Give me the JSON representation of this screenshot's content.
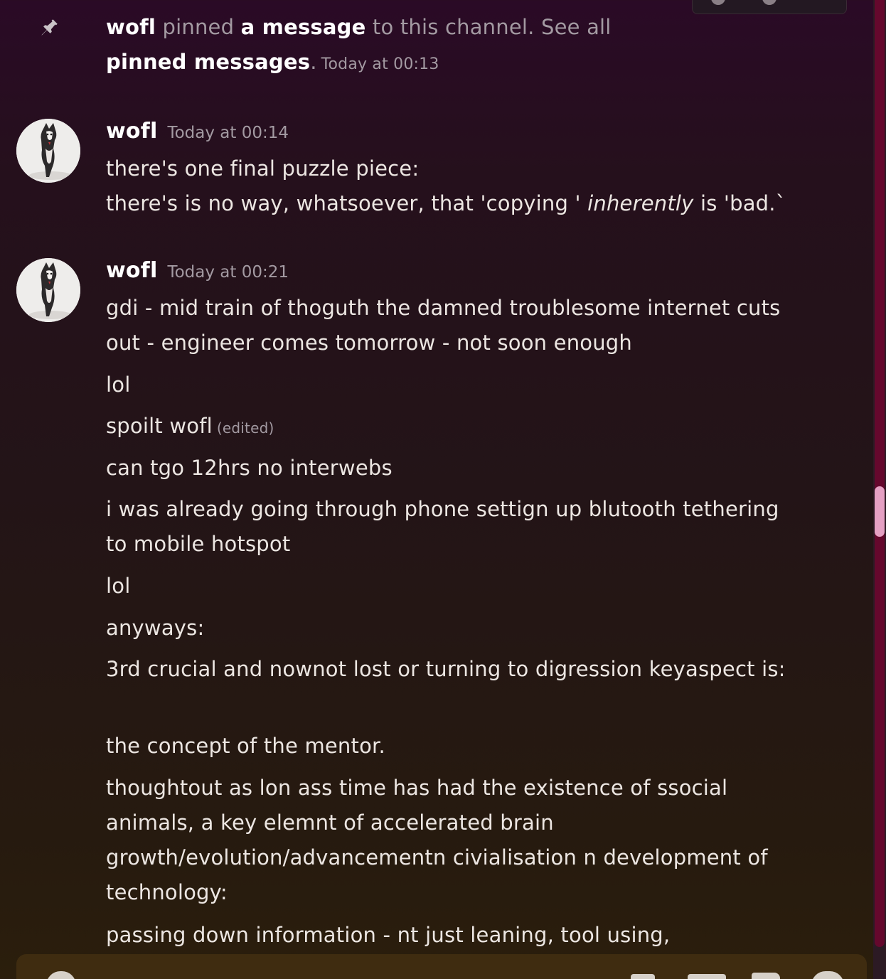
{
  "system_message": {
    "actor": "wofl",
    "action": "pinned",
    "object": "a message",
    "middle": "to this channel. See all",
    "link": "pinned messages",
    "period": ".",
    "timestamp": "Today at 00:13",
    "icon": "pin-icon"
  },
  "messages": [
    {
      "author": "wofl",
      "timestamp": "Today at 00:14",
      "avatar": "husky-avatar",
      "lines": [
        {
          "text": "there's one final puzzle piece:"
        },
        {
          "pre": "there's is no way, whatsoever, that 'copying ' ",
          "italic": "inherently",
          "post": " is 'bad.`"
        }
      ]
    },
    {
      "author": "wofl",
      "timestamp": "Today at 00:21",
      "avatar": "husky-avatar",
      "lines": [
        {
          "text": "gdi - mid train of thoguth the damned troublesome internet cuts out - engineer comes tomorrow - not soon enough"
        },
        {
          "text": "lol"
        },
        {
          "text": "spoilt wofl",
          "edited": "(edited)"
        },
        {
          "text": "can tgo 12hrs no interwebs"
        },
        {
          "text": "i was already going through phone settign up blutooth tethering to mobile hotspot"
        },
        {
          "text": "lol"
        },
        {
          "text": "anyways:"
        },
        {
          "text": "3rd crucial and nownot lost or turning to digression keyaspect is:"
        },
        {
          "text": "the concept of the mentor."
        },
        {
          "text": "thoughtout as lon ass time has had the existence of ssocial animals, a key elemnt of accelerated brain growth/evolution/advancementn civialisation n development of technology:"
        },
        {
          "text": "passing down information - nt just leaning, tool using,"
        }
      ]
    }
  ],
  "composer": {
    "icons": [
      "add-icon",
      "gift-icon",
      "gif-icon",
      "sticker-icon",
      "emoji-icon"
    ]
  }
}
